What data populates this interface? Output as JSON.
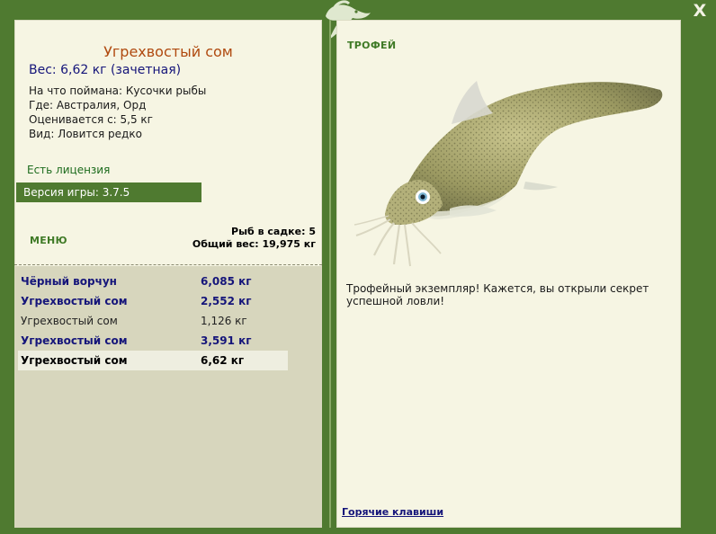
{
  "window": {
    "close_label": "X"
  },
  "fish": {
    "title": "Угрехвостый сом",
    "weight": "Вес: 6,62 кг (зачетная)",
    "info": [
      "На что поймана: Кусочки рыбы",
      "Где: Австралия, Орд",
      "Оценивается с: 5,5 кг",
      "Вид: Ловится редко"
    ]
  },
  "license": "Есть лицензия",
  "version": "Версия игры: 3.7.5",
  "menu_label": "МЕНЮ",
  "keepnet": {
    "count": "Рыб в садке: 5",
    "total": "Общий вес: 19,975 кг"
  },
  "catch_list": [
    {
      "name": "Чёрный ворчун",
      "weight": "6,085 кг",
      "style": "bold"
    },
    {
      "name": "Угрехвостый сом",
      "weight": "2,552 кг",
      "style": "bold"
    },
    {
      "name": "Угрехвостый сом",
      "weight": "1,126 кг",
      "style": "plain"
    },
    {
      "name": "Угрехвостый сом",
      "weight": "3,591 кг",
      "style": "bold"
    },
    {
      "name": "Угрехвостый сом",
      "weight": "6,62 кг",
      "style": "selected"
    }
  ],
  "trophy": {
    "label": "ТРОФЕЙ",
    "text": "Трофейный экземпляр! Кажется, вы открыли секрет успешной ловли!"
  },
  "hotkeys_label": "Горячие клавиши",
  "colors": {
    "frame": "#4f7a30",
    "panel": "#f6f5e3",
    "list_bg": "#d7d6bd",
    "title": "#b04a10",
    "link": "#15157a",
    "accent_green": "#3f7a26"
  },
  "icons": {
    "logo": "fish-logo-icon",
    "close": "close-icon"
  }
}
